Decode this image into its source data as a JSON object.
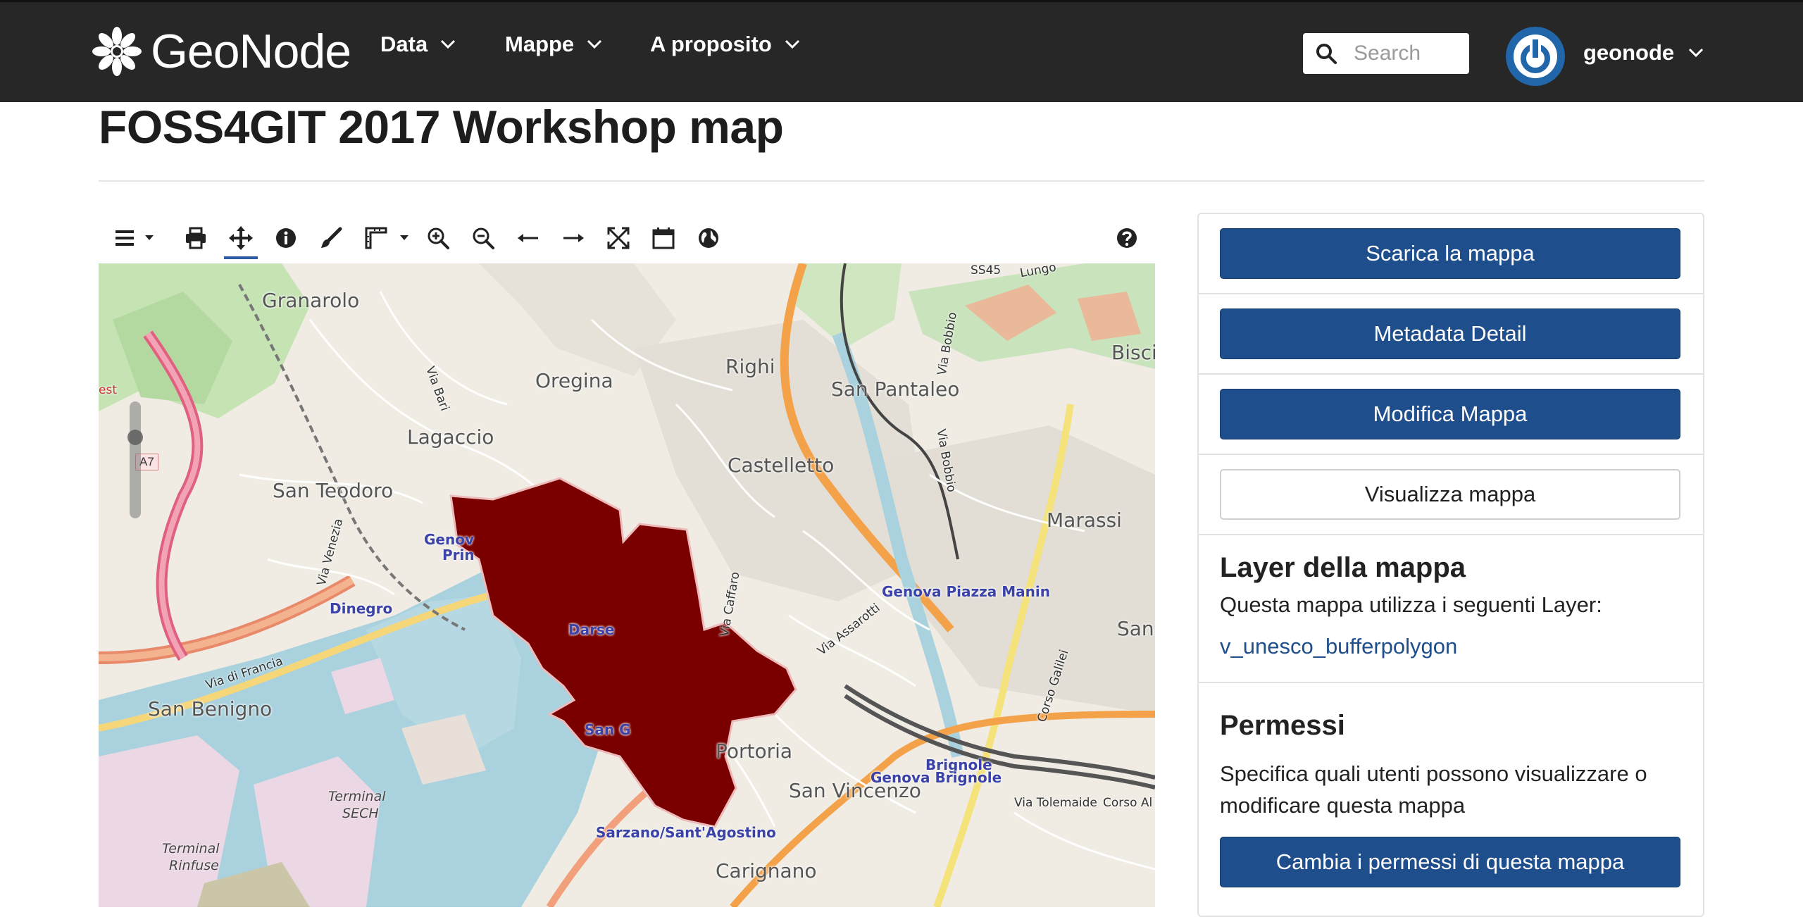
{
  "navbar": {
    "brand": "GeoNode",
    "menus": [
      {
        "label": "Data"
      },
      {
        "label": "Mappe"
      },
      {
        "label": "A proposito"
      }
    ],
    "search_placeholder": "Search",
    "user": "geonode"
  },
  "page": {
    "title": "FOSS4GIT 2017 Workshop map"
  },
  "map": {
    "labels": {
      "granarolo": "Granarolo",
      "oregina": "Oregina",
      "righi": "Righi",
      "san_pantaleo": "San Pantaleo",
      "bisci": "Bisci",
      "lagaccio": "Lagaccio",
      "castelletto": "Castelletto",
      "san_teodoro": "San Teodoro",
      "marassi": "Marassi",
      "genova_piazza_manin": "Genova Piazza Manin",
      "san_right": "San",
      "dinegro": "Dinegro",
      "genova_prin_1": "Genov",
      "genova_prin_2": "Prin",
      "darse": "Darse",
      "san_benigno": "San Benigno",
      "via_di_francia": "Via di Francia",
      "via_venezia": "Via Venezia",
      "via_bari": "Via Bari",
      "via_caffaro": "Via Caffaro",
      "via_assarotti": "Via Assarotti",
      "via_bobbio_1": "Via Bobbio",
      "via_bobbio_2": "Via Bobbio",
      "corso_galilei": "Corso Galilei",
      "san_g": "San G",
      "portoria": "Portoria",
      "brignole_1": "Brignole",
      "brignole_2": "Genova Brignole",
      "san_vincenzo": "San Vincenzo",
      "via_tolemaide": "Via Tolemaide",
      "corso_al": "Corso Al",
      "terminal_sech_1": "Terminal",
      "terminal_sech_2": "SECH",
      "terminal_rinfuse_1": "Terminal",
      "terminal_rinfuse_2": "Rinfuse",
      "sarzano": "Sarzano/Sant'Agostino",
      "carignano": "Carignano",
      "ss45": "SS45",
      "lungo": "Lungo",
      "a7": "A7",
      "west": "est"
    }
  },
  "panel": {
    "buttons": {
      "download": "Scarica la mappa",
      "metadata": "Metadata Detail",
      "edit": "Modifica Mappa",
      "view": "Visualizza mappa"
    },
    "layers": {
      "heading": "Layer della mappa",
      "description": "Questa mappa utilizza i seguenti Layer:",
      "items": [
        "v_unesco_bufferpolygon"
      ]
    },
    "permissions": {
      "heading": "Permessi",
      "description": "Specifica quali utenti possono visualizzare o modificare questa mappa",
      "button": "Cambia i permessi di questa mappa"
    }
  },
  "colors": {
    "navbar": "#272727",
    "primary_button": "#1f4e8c",
    "polygon_fill": "#7a0000",
    "water": "#a9d2de"
  }
}
